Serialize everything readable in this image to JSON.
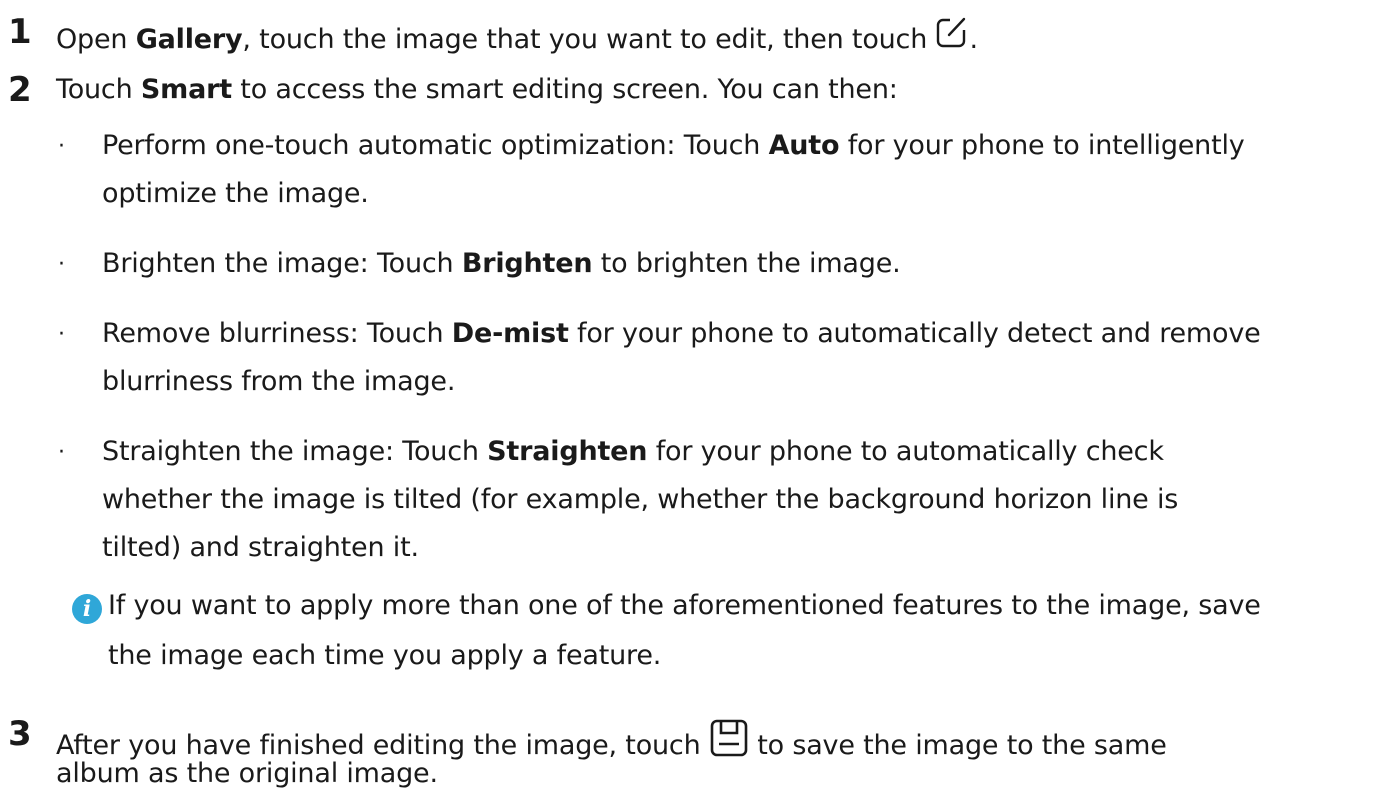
{
  "step1": {
    "number": "1",
    "text_a": "Open ",
    "bold_a": "Gallery",
    "text_b": ", touch the image that you want to edit, then touch ",
    "text_c": ".",
    "icon": "edit-icon"
  },
  "step2": {
    "number": "2",
    "text_a": "Touch ",
    "bold_a": "Smart",
    "text_b": " to access the smart editing screen. You can then:",
    "bullets": [
      {
        "line1_a": "Perform one-touch automatic optimization: Touch ",
        "line1_bold": "Auto",
        "line1_b": " for your phone to intelligently",
        "line2": "optimize the image."
      },
      {
        "line1_a": "Brighten the image: Touch ",
        "line1_bold": "Brighten",
        "line1_b": " to brighten the image."
      },
      {
        "line1_a": "Remove blurriness: Touch ",
        "line1_bold": "De-mist",
        "line1_b": " for your phone to automatically detect and remove",
        "line2": "blurriness from the image."
      },
      {
        "line1_a": "Straighten the image: Touch ",
        "line1_bold": "Straighten",
        "line1_b": " for your phone to automatically check",
        "line2": "whether the image is tilted (for example, whether the background horizon line is",
        "line3": "tilted) and straighten it."
      }
    ],
    "note": {
      "icon": "info-icon",
      "line1": "If you want to apply more than one of the aforementioned features to the image, save",
      "line2": "the image each time you apply a feature."
    }
  },
  "step3": {
    "number": "3",
    "text_a": "After you have finished editing the image, touch ",
    "text_b": " to save the image to the same",
    "line2": "album as the original image.",
    "icon": "save-icon"
  },
  "colors": {
    "text": "#1a1a1a",
    "info_icon": "#2fa7d8"
  }
}
